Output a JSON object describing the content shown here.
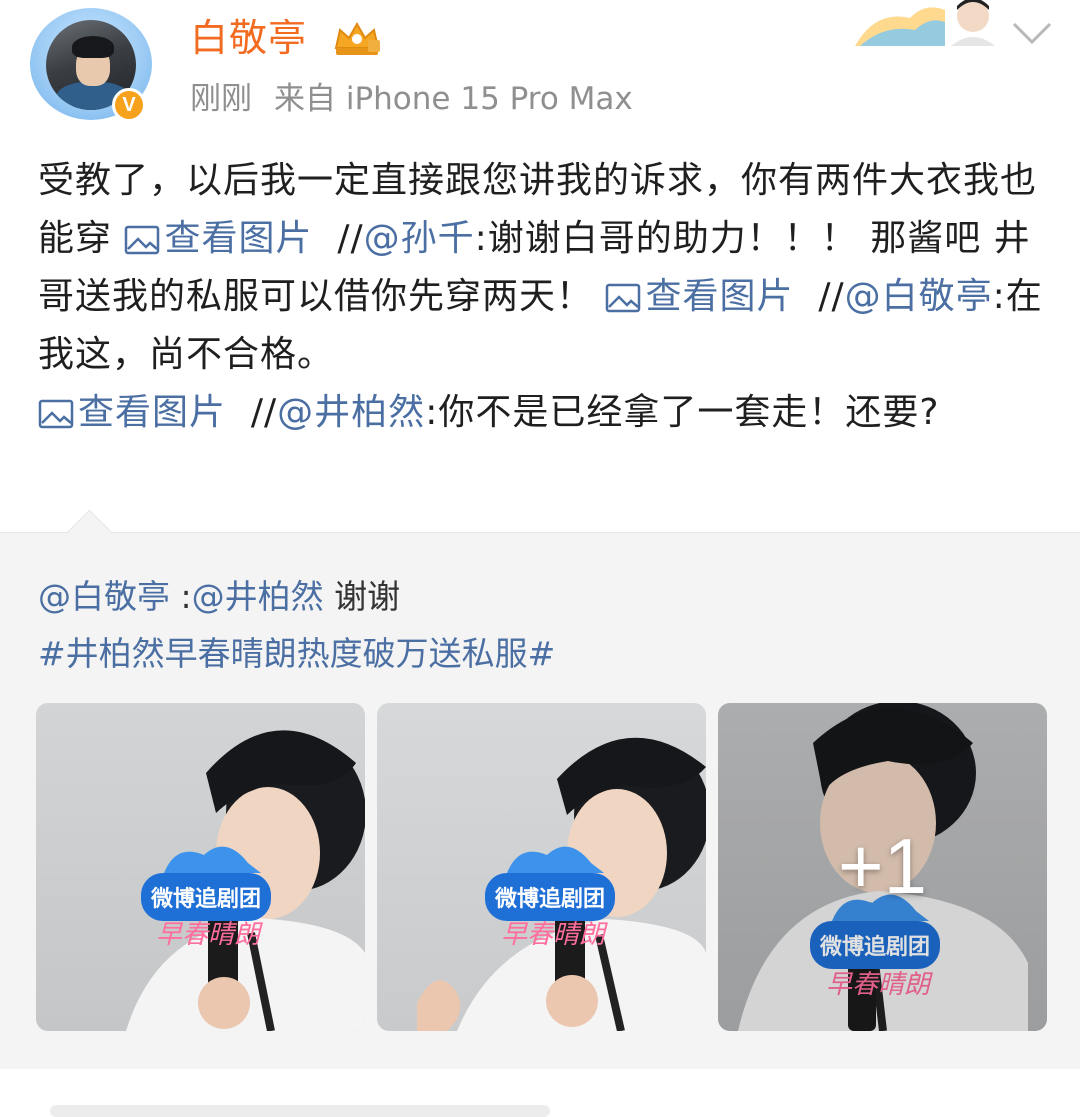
{
  "header": {
    "username": "白敬亭",
    "time": "刚刚",
    "source": "来自 iPhone 15 Pro Max"
  },
  "post": {
    "text_1": "受教了，以后我一定直接跟您讲我的诉求，你有两件大衣我也能穿 ",
    "view_image_label": "查看图片",
    "sep_1": "  //",
    "mention_1": "@孙千",
    "text_2": ":谢谢白哥的助力！！！ 那酱吧 井哥送我的私服可以借你先穿两天！ ",
    "sep_2": "  //",
    "mention_2": "@白敬亭",
    "text_3": ":在我这，尚不合格。\n",
    "sep_3": "  //",
    "mention_3": "@井柏然",
    "text_4": ":你不是已经拿了一套走！还要?"
  },
  "repost": {
    "author": "@白敬亭",
    "colon": " :",
    "mention": "@井柏然",
    "text": " 谢谢",
    "hashtag": "#井柏然早春晴朗热度破万送私服#",
    "images": [
      {
        "caption": "微博追剧团",
        "subcaption": "早春晴朗"
      },
      {
        "caption": "微博追剧团",
        "subcaption": "早春晴朗"
      },
      {
        "caption": "微博追剧团",
        "subcaption": "早春晴朗"
      }
    ],
    "more_count": "+1"
  },
  "colors": {
    "username": "#f26b21",
    "link": "#4b6fa3",
    "meta": "#8f8f8f",
    "repost_bg": "#f4f4f4"
  },
  "icons": [
    "crown-badge-icon",
    "verified-v-icon",
    "image-icon",
    "chevron-down-icon"
  ]
}
